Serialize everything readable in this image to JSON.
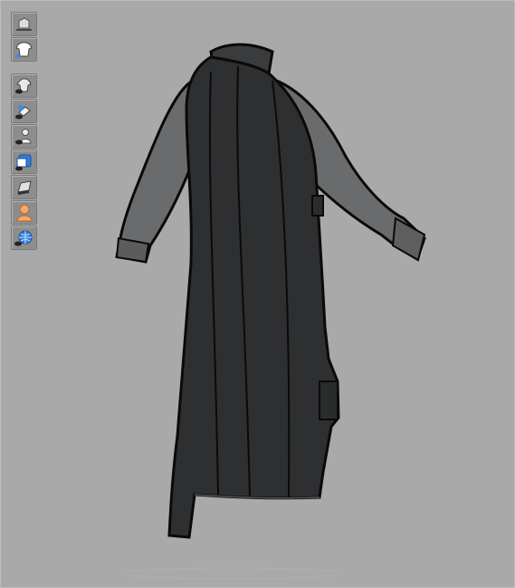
{
  "viewport": {
    "background_color": "#a9a9a9",
    "garment_colors": {
      "coat": "#2e2f31",
      "sleeves": "#6a6b6d",
      "outline": "#0a0a0a"
    }
  },
  "toolbar": {
    "groups": [
      {
        "name": "view-group",
        "tools": [
          {
            "icon": "3d-avatar-view-icon"
          },
          {
            "icon": "garment-2d-pattern-icon"
          }
        ]
      },
      {
        "name": "visibility-group",
        "tools": [
          {
            "icon": "show-garment-icon"
          },
          {
            "icon": "show-pins-icon"
          },
          {
            "icon": "show-avatar-icon"
          },
          {
            "icon": "show-arrangement-icon"
          },
          {
            "icon": "show-fabric-thickness-icon"
          },
          {
            "icon": "avatar-skin-icon"
          },
          {
            "icon": "environment-globe-icon"
          }
        ]
      }
    ]
  }
}
